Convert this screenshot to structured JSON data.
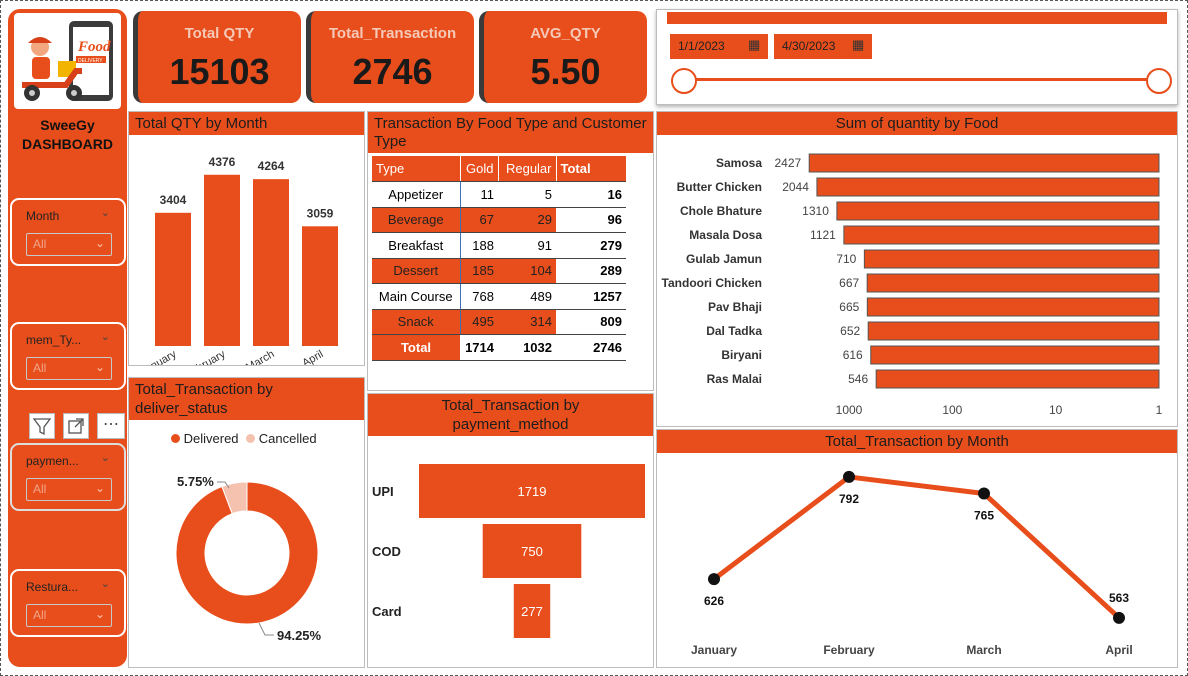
{
  "sidebar": {
    "brand_line1": "SweeGy",
    "brand_line2": "DASHBOARD",
    "logo_text": "Food",
    "logo_sub": "DELIVERY",
    "slicers": [
      {
        "label": "Month",
        "value": "All"
      },
      {
        "label": "mem_Ty...",
        "value": "All"
      },
      {
        "label": "paymen...",
        "value": "All"
      },
      {
        "label": "Restura...",
        "value": "All"
      }
    ]
  },
  "kpis": [
    {
      "title": "Total QTY",
      "value": "15103"
    },
    {
      "title": "Total_Transaction",
      "value": "2746"
    },
    {
      "title": "AVG_QTY",
      "value": "5.50"
    }
  ],
  "date_slicer": {
    "start": "1/1/2023",
    "end": "4/30/2023"
  },
  "qty_by_month": {
    "title": "Total QTY by Month",
    "chart_data": {
      "type": "bar",
      "categories": [
        "January",
        "February",
        "March",
        "April"
      ],
      "values": [
        3404,
        4376,
        4264,
        3059
      ],
      "ylim": [
        0,
        4600
      ]
    }
  },
  "matrix": {
    "title": "Transaction By Food Type and Customer Type",
    "headers": [
      "Type",
      "Gold",
      "Regular",
      "Total"
    ],
    "rows": [
      {
        "type": "Appetizer",
        "gold": "11",
        "regular": "5",
        "total": "16",
        "hl": false
      },
      {
        "type": "Beverage",
        "gold": "67",
        "regular": "29",
        "total": "96",
        "hl": true
      },
      {
        "type": "Breakfast",
        "gold": "188",
        "regular": "91",
        "total": "279",
        "hl": false
      },
      {
        "type": "Dessert",
        "gold": "185",
        "regular": "104",
        "total": "289",
        "hl": true
      },
      {
        "type": "Main Course",
        "gold": "768",
        "regular": "489",
        "total": "1257",
        "hl": false
      },
      {
        "type": "Snack",
        "gold": "495",
        "regular": "314",
        "total": "809",
        "hl": true
      }
    ],
    "total_row": {
      "type": "Total",
      "gold": "1714",
      "regular": "1032",
      "total": "2746"
    }
  },
  "food_qty": {
    "title": "Sum of quantity by Food",
    "axis_ticks": [
      "1000",
      "100",
      "10",
      "1"
    ],
    "chart_data": {
      "type": "bar",
      "orientation": "horizontal",
      "scale": "log",
      "categories": [
        "Samosa",
        "Butter Chicken",
        "Chole Bhature",
        "Masala Dosa",
        "Gulab Jamun",
        "Tandoori Chicken",
        "Pav Bhaji",
        "Dal Tadka",
        "Biryani",
        "Ras Malai"
      ],
      "values": [
        2427,
        2044,
        1310,
        1121,
        710,
        667,
        665,
        652,
        616,
        546
      ]
    }
  },
  "deliver_status": {
    "title_line1": "Total_Transaction by",
    "title_line2": "deliver_status",
    "legend": [
      {
        "name": "Delivered",
        "color": "#e84e1b"
      },
      {
        "name": "Cancelled",
        "color": "#f4c2ae"
      }
    ],
    "chart_data": {
      "type": "pie",
      "labels": [
        "Delivered",
        "Cancelled"
      ],
      "values": [
        94.25,
        5.75
      ],
      "display": [
        "94.25%",
        "5.75%"
      ]
    }
  },
  "payment": {
    "title_line1": "Total_Transaction by",
    "title_line2": "payment_method",
    "chart_data": {
      "type": "bar",
      "categories": [
        "UPI",
        "COD",
        "Card"
      ],
      "values": [
        1719,
        750,
        277
      ]
    }
  },
  "tx_by_month": {
    "title": "Total_Transaction by Month",
    "chart_data": {
      "type": "line",
      "categories": [
        "January",
        "February",
        "March",
        "April"
      ],
      "values": [
        626,
        792,
        765,
        563
      ],
      "ylim": [
        540,
        800
      ]
    }
  },
  "visual_toolbar": {
    "more_label": "⋯"
  },
  "colors": {
    "accent": "#e84e1b",
    "light_accent": "#f4c2ae",
    "dark": "#1a1a1a"
  }
}
